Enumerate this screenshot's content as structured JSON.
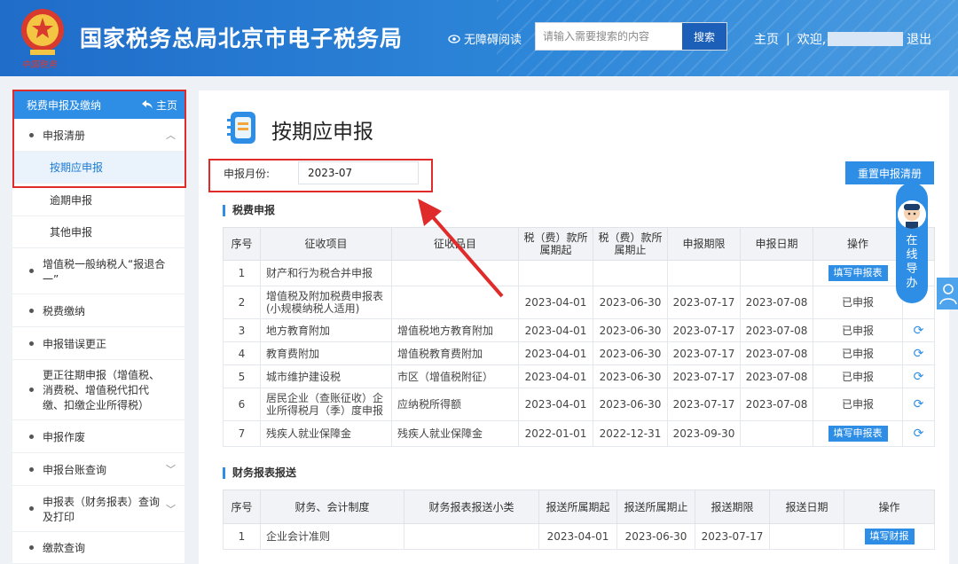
{
  "header": {
    "site_title": "国家税务总局北京市电子税务局",
    "emblem_sub": "中国税务",
    "accessibility": "无障碍阅读",
    "search_placeholder": "请输入需要搜索的内容",
    "search_button": "搜索",
    "home": "主页",
    "separator": "|",
    "welcome": "欢迎,",
    "logout": "退出"
  },
  "sidebar": {
    "head_title": "税费申报及缴纳",
    "head_home": "主页",
    "items": [
      {
        "label": "申报清册"
      },
      {
        "label": "按期应申报"
      },
      {
        "label": "逾期申报"
      },
      {
        "label": "其他申报"
      },
      {
        "label": "增值税一般纳税人“报退合一”"
      },
      {
        "label": "税费缴纳"
      },
      {
        "label": "申报错误更正"
      },
      {
        "label": "更正往期申报（增值税、消费税、增值税代扣代缴、扣缴企业所得税）"
      },
      {
        "label": "申报作废"
      },
      {
        "label": "申报台账查询"
      },
      {
        "label": "申报表（财务报表）查询及打印"
      },
      {
        "label": "缴款查询"
      }
    ]
  },
  "main": {
    "title": "按期应申报",
    "period_label": "申报月份:",
    "period_value": "2023-07",
    "reset_button": "重置申报清册",
    "tax_section": "税费申报",
    "tax_headers": [
      "序号",
      "征收项目",
      "征收品目",
      "税（费）款所属期起",
      "税（费）款所属期止",
      "申报期限",
      "申报日期",
      "操作",
      ""
    ],
    "tax_rows": [
      {
        "no": "1",
        "item": "财产和行为税合并申报",
        "sub": "",
        "start": "",
        "end": "",
        "deadline": "",
        "date": "",
        "status": "",
        "button": "填写申报表",
        "refresh": false
      },
      {
        "no": "2",
        "item": "增值税及附加税费申报表(小规模纳税人适用)",
        "sub": "",
        "start": "2023-04-01",
        "end": "2023-06-30",
        "deadline": "2023-07-17",
        "date": "2023-07-08",
        "status": "已申报",
        "button": "",
        "refresh": false
      },
      {
        "no": "3",
        "item": "地方教育附加",
        "sub": "增值税地方教育附加",
        "start": "2023-04-01",
        "end": "2023-06-30",
        "deadline": "2023-07-17",
        "date": "2023-07-08",
        "status": "已申报",
        "button": "",
        "refresh": true
      },
      {
        "no": "4",
        "item": "教育费附加",
        "sub": "增值税教育费附加",
        "start": "2023-04-01",
        "end": "2023-06-30",
        "deadline": "2023-07-17",
        "date": "2023-07-08",
        "status": "已申报",
        "button": "",
        "refresh": true
      },
      {
        "no": "5",
        "item": "城市维护建设税",
        "sub": "市区（增值税附征）",
        "start": "2023-04-01",
        "end": "2023-06-30",
        "deadline": "2023-07-17",
        "date": "2023-07-08",
        "status": "已申报",
        "button": "",
        "refresh": true
      },
      {
        "no": "6",
        "item": "居民企业（查账征收）企业所得税月（季）度申报",
        "sub": "应纳税所得额",
        "start": "2023-04-01",
        "end": "2023-06-30",
        "deadline": "2023-07-17",
        "date": "2023-07-08",
        "status": "已申报",
        "button": "",
        "refresh": true
      },
      {
        "no": "7",
        "item": "残疾人就业保障金",
        "sub": "残疾人就业保障金",
        "start": "2022-01-01",
        "end": "2022-12-31",
        "deadline": "2023-09-30",
        "date": "",
        "status": "",
        "button": "填写申报表",
        "refresh": true
      }
    ],
    "fin_section": "财务报表报送",
    "fin_headers": [
      "序号",
      "财务、会计制度",
      "财务报表报送小类",
      "报送所属期起",
      "报送所属期止",
      "报送期限",
      "报送日期",
      "操作"
    ],
    "fin_rows": [
      {
        "no": "1",
        "system": "企业会计准则",
        "sub": "",
        "start": "2023-04-01",
        "end": "2023-06-30",
        "deadline": "2023-07-17",
        "date": "",
        "button": "填写财报"
      }
    ]
  },
  "guide": {
    "label": "在线导办"
  },
  "colors": {
    "accent": "#2e8ee6",
    "highlight": "#e02b2b"
  }
}
